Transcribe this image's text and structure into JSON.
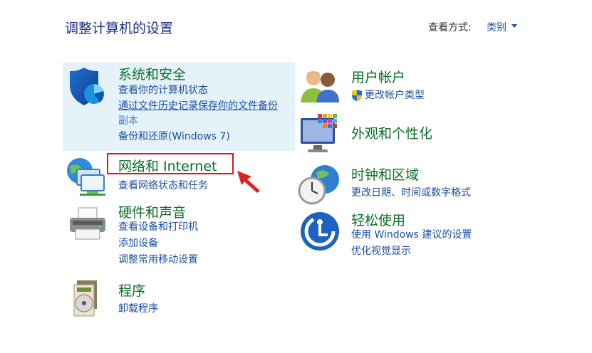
{
  "page": {
    "title": "调整计算机的设置",
    "view_label": "查看方式:",
    "view_value": "类别"
  },
  "left": {
    "system": {
      "title": "系统和安全",
      "links": [
        "查看你的计算机状态",
        "通过文件历史记录保存你的文件备份",
        "副本",
        "备份和还原(Windows 7)"
      ]
    },
    "network": {
      "title": "网络和 Internet",
      "links": [
        "查看网络状态和任务"
      ]
    },
    "hardware": {
      "title": "硬件和声音",
      "links": [
        "查看设备和打印机",
        "添加设备",
        "调整常用移动设置"
      ]
    },
    "programs": {
      "title": "程序",
      "links": [
        "卸载程序"
      ]
    }
  },
  "right": {
    "accounts": {
      "title": "用户帐户",
      "links": [
        "更改帐户类型"
      ]
    },
    "appearance": {
      "title": "外观和个性化"
    },
    "clock": {
      "title": "时钟和区域",
      "links": [
        "更改日期、时间或数字格式"
      ]
    },
    "ease": {
      "title": "轻松使用",
      "links": [
        "使用 Windows 建议的设置",
        "优化视觉显示"
      ]
    }
  },
  "colors": {
    "title_green": "#0a6e28",
    "link_blue": "#1a4fa0",
    "highlight_bg": "#e6f2fa",
    "annotation_red": "#d7191b"
  },
  "icons": [
    "shield-icon",
    "network-icon",
    "printer-icon",
    "programs-icon",
    "users-icon",
    "uac-shield-icon",
    "monitor-icon",
    "clock-globe-icon",
    "ease-of-access-icon",
    "red-arrow-annotation"
  ]
}
